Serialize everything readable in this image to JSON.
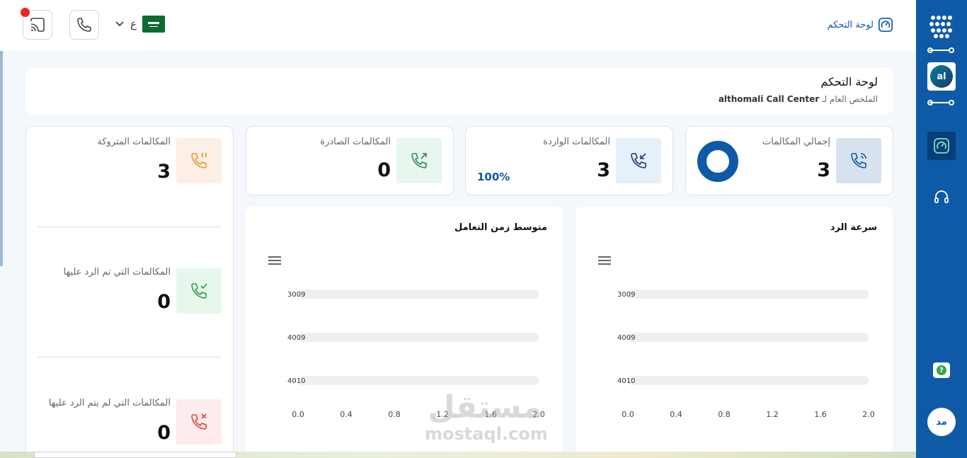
{
  "topbar": {
    "brand_label": "لوحة التحكم",
    "language_label": "ع"
  },
  "header": {
    "title": "لوحة التحكم",
    "subtitle_prefix": "الملخص العام لـ",
    "subtitle_org": "althomali Call Center"
  },
  "stats": {
    "total": {
      "label": "إجمالي المكالمات",
      "value": "3"
    },
    "incoming": {
      "label": "المكالمات الواردة",
      "value": "3",
      "percent": "100%"
    },
    "outgoing": {
      "label": "المكالمات الصادرة",
      "value": "0"
    },
    "abandoned": {
      "label": "المكالمات المتروكة",
      "value": "3"
    },
    "answered": {
      "label": "المكالمات التي تم الرد عليها",
      "value": "0"
    },
    "unanswered": {
      "label": "المكالمات التي لم يتم الرد عليها",
      "value": "0"
    }
  },
  "rail": {
    "avatar_initials": "al",
    "help_label": "?",
    "user_initials": "مد"
  },
  "watermark": {
    "arabic": "مستقل",
    "latin": "mostaql.com"
  },
  "colors": {
    "primary": "#0e5aa7",
    "rail": "#0e5aa7",
    "notification": "#e8261f"
  },
  "chart_data": [
    {
      "type": "bar",
      "title": "سرعة الرد",
      "categories": [
        "3009",
        "4009",
        "4010"
      ],
      "values": [
        0,
        0,
        0
      ],
      "xlim": [
        0,
        2.0
      ],
      "xticks": [
        "0.0",
        "0.4",
        "0.8",
        "1.2",
        "1.6",
        "2.0"
      ],
      "orientation": "horizontal"
    },
    {
      "type": "bar",
      "title": "متوسط زمن التعامل",
      "categories": [
        "3009",
        "4009",
        "4010"
      ],
      "values": [
        0,
        0,
        0
      ],
      "xlim": [
        0,
        2.0
      ],
      "xticks": [
        "0.0",
        "0.4",
        "0.8",
        "1.2",
        "1.6",
        "2.0"
      ],
      "orientation": "horizontal"
    }
  ]
}
